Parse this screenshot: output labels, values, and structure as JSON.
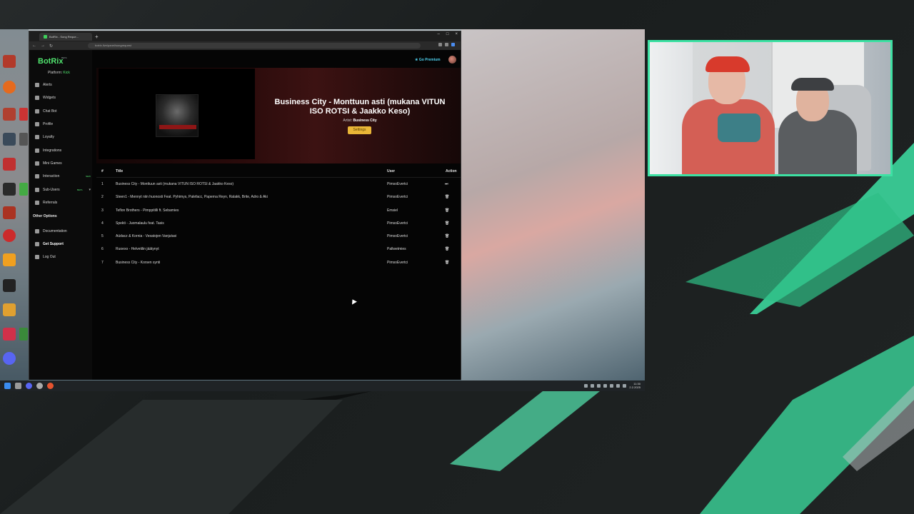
{
  "browser": {
    "tab_label": "BotRix - Song Reque...",
    "url": "botrix.live/panel/songrequest",
    "new_tab": "+",
    "win_controls": [
      "–",
      "□",
      "×"
    ]
  },
  "app": {
    "logo": "BotRix",
    "logo_tag": "BETA",
    "platform_label": "Platform:",
    "platform_value": "Kick",
    "premium": "Go Premium",
    "nav": [
      {
        "label": "Alerts",
        "icon": "bell-icon"
      },
      {
        "label": "Widgets",
        "icon": "widgets-icon"
      },
      {
        "label": "Chat Bot",
        "icon": "robot-icon"
      },
      {
        "label": "Profile",
        "icon": "user-icon"
      },
      {
        "label": "Loyalty",
        "icon": "star-icon"
      },
      {
        "label": "Integrations",
        "icon": "link-icon"
      },
      {
        "label": "Mini Games",
        "icon": "gamepad-icon"
      },
      {
        "label": "Interaction",
        "icon": "music-icon",
        "badge": "NEW"
      },
      {
        "label": "Sub-Users",
        "icon": "users-icon",
        "badge": "BETA"
      },
      {
        "label": "Referrals",
        "icon": "referral-icon"
      }
    ],
    "other_options_label": "Other Options",
    "other_nav": [
      {
        "label": "Documentation",
        "icon": "doc-icon"
      },
      {
        "label": "Get Support",
        "icon": "support-icon"
      },
      {
        "label": "Log Out",
        "icon": "logout-icon"
      }
    ]
  },
  "now_playing": {
    "title": "Business City - Monttuun asti (mukana VITUN ISO ROTSI & Jaakko Keso)",
    "artist_label": "Artist:",
    "artist": "Business City",
    "settings_label": "Settings"
  },
  "queue": {
    "headers": {
      "num": "#",
      "title": "Title",
      "user": "User",
      "action": "Action"
    },
    "rows": [
      {
        "num": "1",
        "title": "Business City - Monttuun asti (mukana VITUN ISO ROTSI & Jaakko Keso)",
        "user": "PimsoEvertci",
        "action": "⏭"
      },
      {
        "num": "2",
        "title": "Steen1 - Mennyt niin huonosti Feat. Pyhimys, Palefacc, Paperna Reyn, Ralakk, Brite, Adro & Aki",
        "user": "PimsoEvertci",
        "action": "🗑"
      },
      {
        "num": "3",
        "title": "Teflon Brothers - Pimppitilli ft. Sebamies",
        "user": "Emsiel",
        "action": "🗑"
      },
      {
        "num": "4",
        "title": "Spekti - Juomalaulu feat. Tasis",
        "user": "PimsoEvertci",
        "action": "🗑"
      },
      {
        "num": "5",
        "title": "Aüdacz & Kornia - Vesatojen Vanjutasi",
        "user": "PimsoEvertci",
        "action": "🗑"
      },
      {
        "num": "6",
        "title": "Ruoexo - Helvetilin jäätynyt",
        "user": "Pallwetmies",
        "action": "🗑"
      },
      {
        "num": "7",
        "title": "Business City - Korsen synti",
        "user": "PimsoEvertci",
        "action": "🗑"
      }
    ]
  },
  "taskbar": {
    "time": "11:30",
    "date": "2.2.2025"
  },
  "colors": {
    "brand": "#50e36e",
    "accent_button": "#e9b637",
    "cam_border": "#3de1a3"
  }
}
